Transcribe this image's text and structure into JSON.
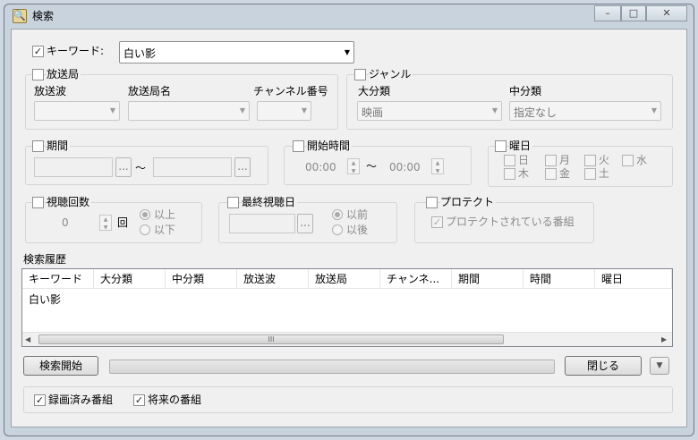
{
  "window": {
    "title": "検索",
    "icon": "search-app-icon",
    "minimize": "–",
    "maximize": "□",
    "close": "✕"
  },
  "keyword": {
    "label": "キーワード:",
    "checked": true,
    "value": "白い影"
  },
  "broadcaster": {
    "label": "放送局",
    "checked": false,
    "wave_label": "放送波",
    "station_label": "放送局名",
    "channel_label": "チャンネル番号"
  },
  "genre": {
    "label": "ジャンル",
    "checked": false,
    "major_label": "大分類",
    "major_value": "映画",
    "minor_label": "中分類",
    "minor_value": "指定なし"
  },
  "period": {
    "label": "期間",
    "checked": false,
    "tilde": "～",
    "dots": "..."
  },
  "start_time": {
    "label": "開始時間",
    "checked": false,
    "from": "00:00",
    "tilde": "～",
    "to": "00:00"
  },
  "weekday": {
    "label": "曜日",
    "checked": false,
    "days": [
      "日",
      "月",
      "火",
      "水",
      "木",
      "金",
      "土"
    ]
  },
  "view_count": {
    "label": "視聴回数",
    "checked": false,
    "value": "0",
    "unit": "回",
    "opt_above": "以上",
    "opt_below": "以下"
  },
  "last_viewed": {
    "label": "最終視聴日",
    "checked": false,
    "opt_before": "以前",
    "opt_after": "以後",
    "dots": "..."
  },
  "protect": {
    "label": "プロテクト",
    "checked": false,
    "sub_label": "プロテクトされている番組",
    "sub_checked": true
  },
  "history": {
    "label": "検索履歴",
    "columns": [
      "キーワード",
      "大分類",
      "中分類",
      "放送波",
      "放送局",
      "チャンネ...",
      "期間",
      "時間",
      "曜日"
    ],
    "rows": [
      [
        "白い影",
        "",
        "",
        "",
        "",
        "",
        "",
        "",
        ""
      ]
    ],
    "scroll_grip": "III"
  },
  "actions": {
    "search_label": "検索開始",
    "close_label": "閉じる",
    "progress": 0
  },
  "footer": {
    "recorded_label": "録画済み番組",
    "recorded_checked": true,
    "future_label": "将来の番組",
    "future_checked": true
  }
}
